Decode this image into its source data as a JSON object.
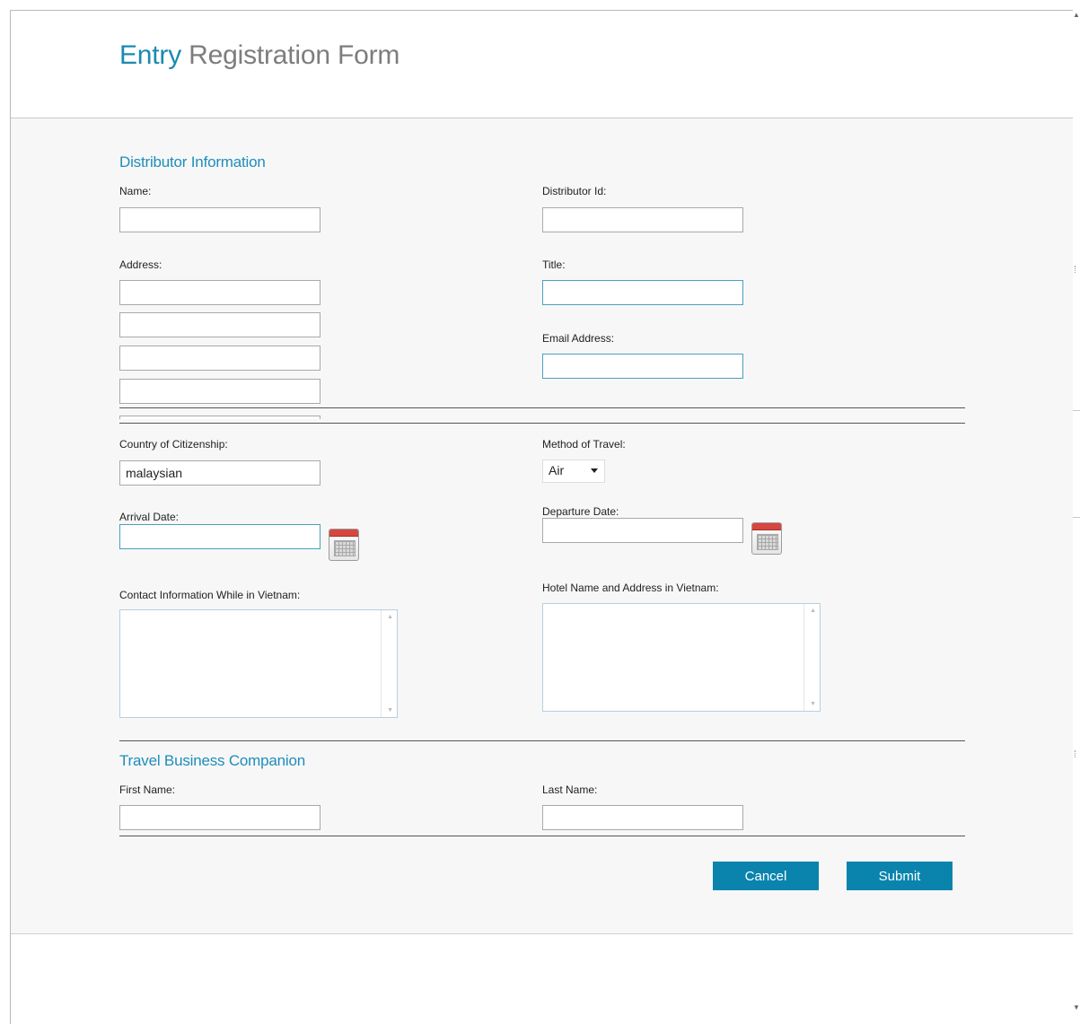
{
  "header": {
    "title_first": "Entry",
    "title_rest": " Registration Form"
  },
  "distributor": {
    "heading": "Distributor Information",
    "name_label": "Name:",
    "name_value": "",
    "distributor_id_label": "Distributor Id:",
    "distributor_id_value": "",
    "address_label": "Address:",
    "address_lines": [
      "",
      "",
      "",
      ""
    ],
    "title_label": "Title:",
    "title_value": "",
    "email_label": "Email Address:",
    "email_value": ""
  },
  "travel": {
    "citizenship_label": "Country of Citizenship:",
    "citizenship_value": "malaysian",
    "method_label": "Method of Travel:",
    "method_value": "Air",
    "arrival_label": "Arrival Date:",
    "arrival_value": "",
    "departure_label": "Departure Date:",
    "departure_value": "",
    "contact_label": "Contact Information While in Vietnam:",
    "contact_value": "",
    "hotel_label": "Hotel Name and Address in Vietnam:",
    "hotel_value": ""
  },
  "companion": {
    "heading": "Travel Business Companion",
    "first_name_label": "First Name:",
    "first_name_value": "",
    "last_name_label": "Last Name:",
    "last_name_value": ""
  },
  "actions": {
    "cancel_label": "Cancel",
    "submit_label": "Submit"
  },
  "colors": {
    "accent": "#1a8ab0",
    "button": "#0a84ad",
    "heading": "#1f8dbb",
    "muted_title": "#7d7d7d"
  },
  "icons": {
    "calendar": "calendar-icon",
    "dropdown": "chevron-down-icon"
  }
}
